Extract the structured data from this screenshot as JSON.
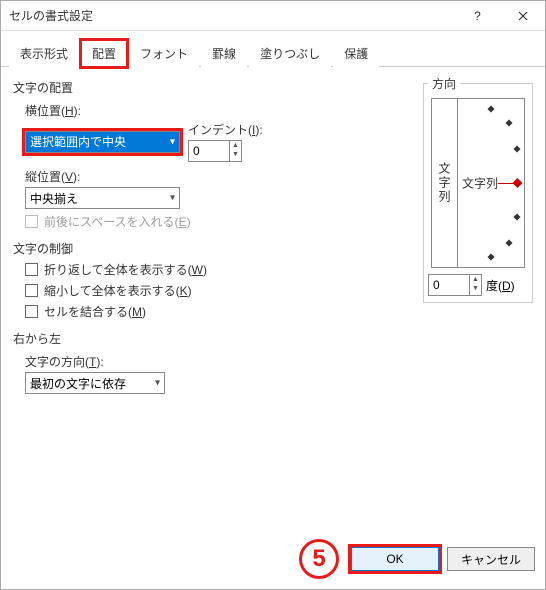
{
  "window": {
    "title": "セルの書式設定"
  },
  "tabs": [
    "表示形式",
    "配置",
    "フォント",
    "罫線",
    "塗りつぶし",
    "保護"
  ],
  "activeTab": 1,
  "alignment": {
    "groupLabel": "文字の配置",
    "horizLabelA": "横位置(",
    "horizLabelU": "H",
    "horizLabelB": "):",
    "horizValue": "選択範囲内で中央",
    "indentLabelA": "インデント(",
    "indentLabelU": "I",
    "indentLabelB": "):",
    "indentValue": "0",
    "vertLabelA": "縦位置(",
    "vertLabelU": "V",
    "vertLabelB": "):",
    "vertValue": "中央揃え",
    "spacingA": "前後にスペースを入れる(",
    "spacingU": "E",
    "spacingB": ")"
  },
  "control": {
    "groupLabel": "文字の制御",
    "wrapA": "折り返して全体を表示する(",
    "wrapU": "W",
    "wrapB": ")",
    "shrinkA": "縮小して全体を表示する(",
    "shrinkU": "K",
    "shrinkB": ")",
    "mergeA": "セルを結合する(",
    "mergeU": "M",
    "mergeB": ")"
  },
  "rtl": {
    "groupLabel": "右から左",
    "dirLabelA": "文字の方向(",
    "dirLabelU": "T",
    "dirLabelB": "):",
    "dirValue": "最初の文字に依存"
  },
  "orient": {
    "legend": "方向",
    "vertText": "文字列",
    "horizText": "文字列",
    "degValue": "0",
    "degA": "度(",
    "degU": "D",
    "degB": ")"
  },
  "footer": {
    "step": "5",
    "ok": "OK",
    "cancel": "キャンセル"
  }
}
